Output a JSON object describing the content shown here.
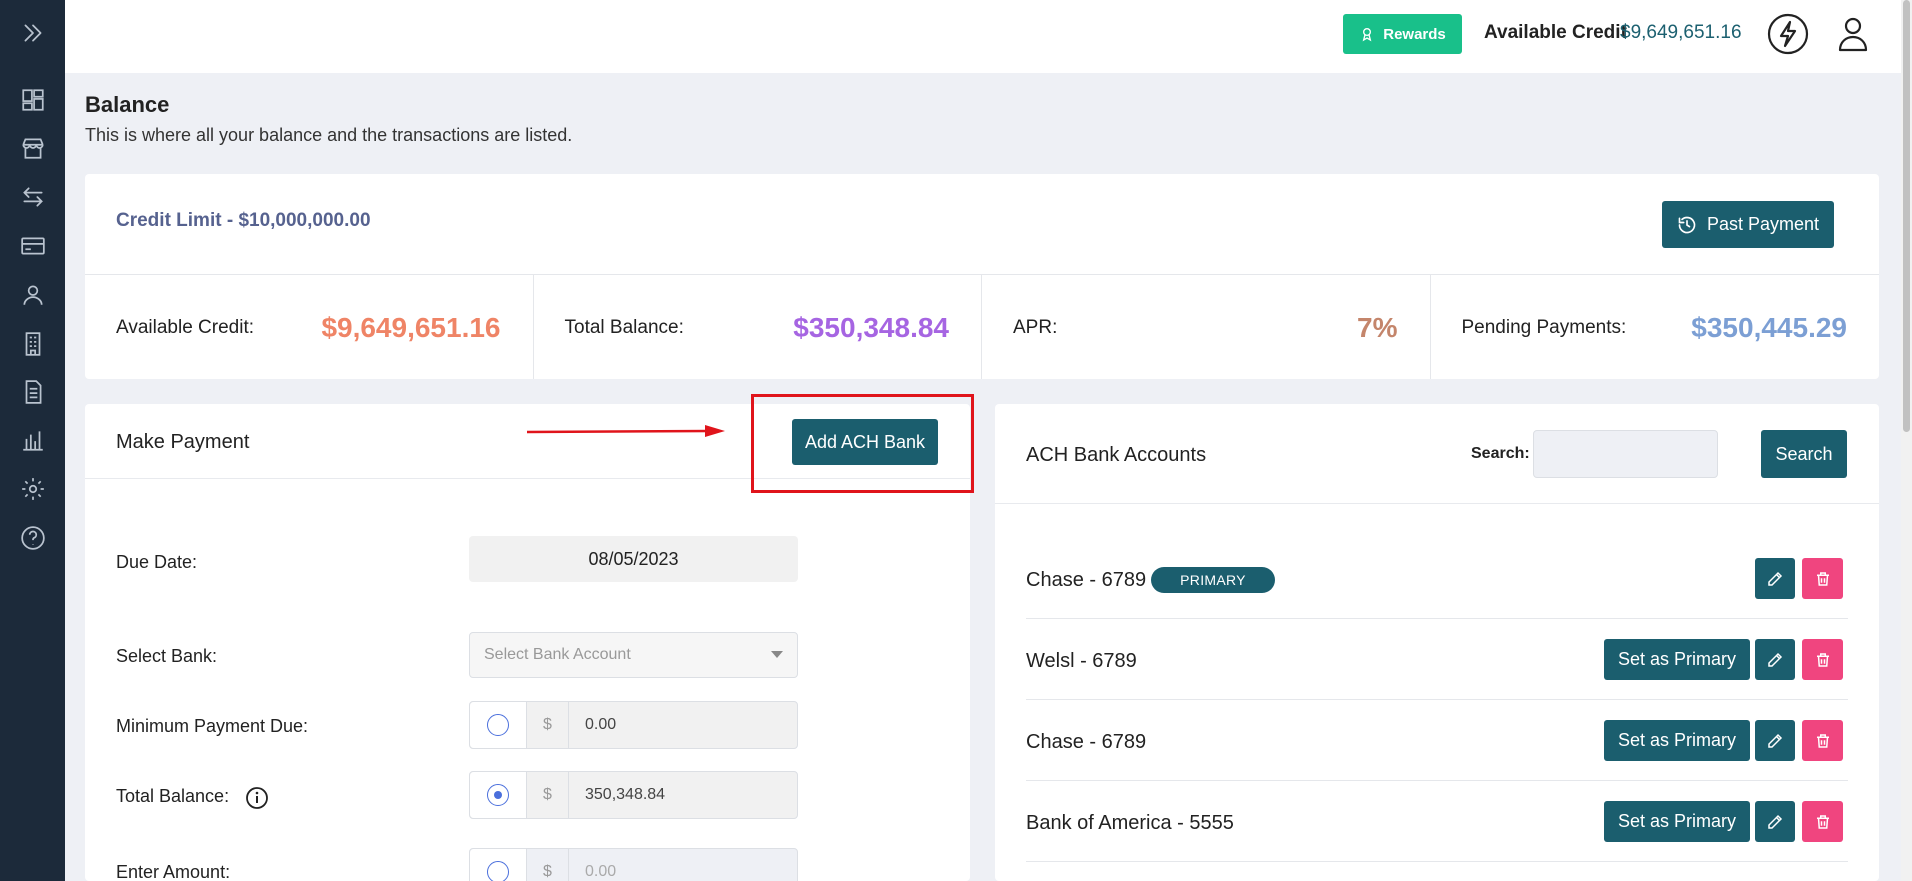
{
  "topbar": {
    "rewards_label": "Rewards",
    "available_credit_label": "Available Credit",
    "available_credit_value": "$9,649,651.16"
  },
  "sidebar": {
    "items": [
      "expand",
      "dashboard",
      "store",
      "transfers",
      "cards",
      "users",
      "buildings",
      "documents",
      "reports",
      "settings",
      "help"
    ]
  },
  "page": {
    "title": "Balance",
    "subtitle": "This is where all your balance and the transactions are listed."
  },
  "credit": {
    "limit_text": "Credit Limit - $10,000,000.00",
    "past_payment_label": "Past Payment",
    "stats": [
      {
        "label": "Available Credit:",
        "value": "$9,649,651.16",
        "color": "#ef8466"
      },
      {
        "label": "Total Balance:",
        "value": "$350,348.84",
        "color": "#a665e2"
      },
      {
        "label": "APR:",
        "value": "7%",
        "color": "#c4856b"
      },
      {
        "label": "Pending Payments:",
        "value": "$350,445.29",
        "color": "#7c9fd4"
      }
    ]
  },
  "payment": {
    "title": "Make Payment",
    "add_ach_label": "Add ACH Bank",
    "due_date_label": "Due Date:",
    "due_date_value": "08/05/2023",
    "select_bank_label": "Select Bank:",
    "select_bank_placeholder": "Select Bank Account",
    "min_payment_label": "Minimum Payment Due:",
    "min_payment_currency": "$",
    "min_payment_value": "0.00",
    "total_balance_label": "Total Balance:",
    "total_balance_currency": "$",
    "total_balance_value": "350,348.84",
    "enter_amount_label": "Enter Amount:",
    "enter_amount_currency": "$",
    "enter_amount_placeholder": "0.00"
  },
  "ach": {
    "title": "ACH Bank Accounts",
    "search_label": "Search:",
    "search_button": "Search",
    "primary_badge": "PRIMARY",
    "set_primary_label": "Set as Primary",
    "banks": [
      {
        "name": "Chase - 6789"
      },
      {
        "name": "Welsl - 6789"
      },
      {
        "name": "Chase - 6789"
      },
      {
        "name": "Bank of America - 5555"
      }
    ]
  },
  "colors": {
    "sidebar_bg": "#1c2a3a",
    "accent": "#1b5e6e",
    "rewards": "#19c08a",
    "delete": "#f0457f",
    "highlight": "#e0141b"
  }
}
